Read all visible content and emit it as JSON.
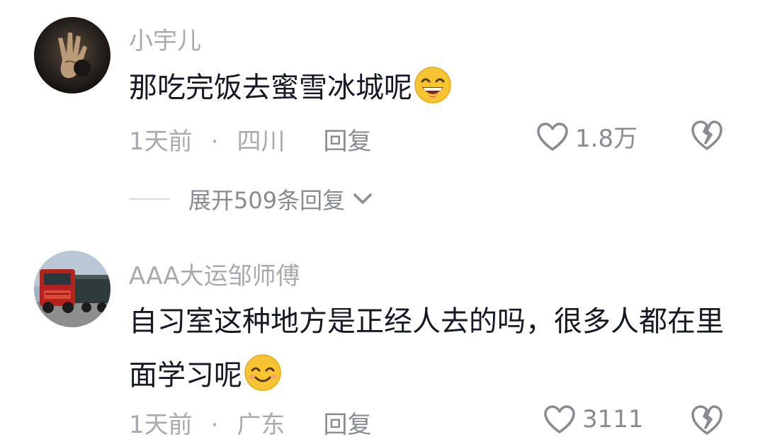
{
  "comments": [
    {
      "username": "小宇儿",
      "text": "那吃完饭去蜜雪冰城呢",
      "emoji": "grinning-sweat-emoji",
      "time": "1天前",
      "separator": "·",
      "location": "四川",
      "reply_label": "回复",
      "likes": "1.8万"
    },
    {
      "username": "AAA大运邹师傅",
      "text": "自习室这种地方是正经人去的吗，很多人都在里面学习呢",
      "emoji": "smiling-blush-emoji",
      "time": "1天前",
      "separator": "·",
      "location": "广东",
      "reply_label": "回复",
      "likes": "3111"
    }
  ],
  "expand_replies": {
    "label": "展开509条回复"
  },
  "colors": {
    "meta_gray": "#a9aaae",
    "text_dark": "#161823",
    "emoji_yellow": "#f7c531"
  }
}
